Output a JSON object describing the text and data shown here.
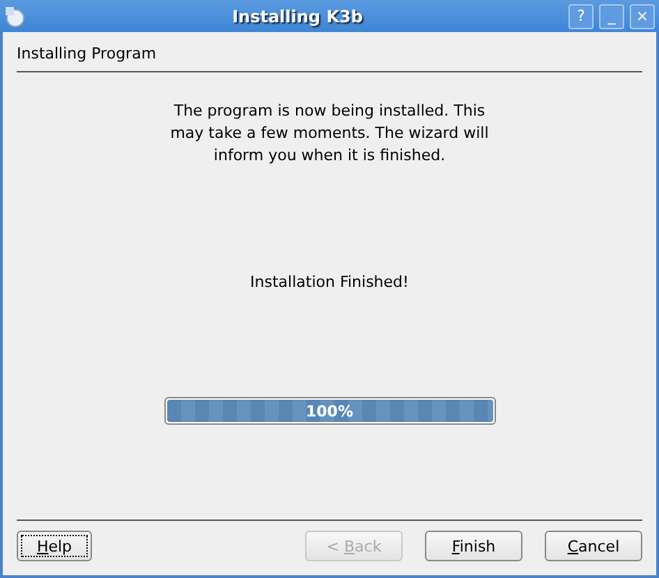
{
  "window": {
    "title": "Installing K3b",
    "controls": [
      "?",
      "_",
      "×"
    ]
  },
  "page_title": "Installing Program",
  "message": "The program is now being installed. This may take a few moments. The wizard will inform you when it is finished.",
  "status": "Installation Finished!",
  "progress": {
    "level": 1,
    "reading": "100%"
  },
  "buttons": [
    {
      "key": "H",
      "after": "elp",
      "disabled": false,
      "focused": true
    },
    {
      "before": "< ",
      "key": "B",
      "after": "ack",
      "disabled": true,
      "focused": false
    },
    {
      "key": "F",
      "after": "inish",
      "disabled": false,
      "focused": false
    },
    {
      "key": "C",
      "after": "ancel",
      "disabled": false,
      "focused": false
    }
  ]
}
